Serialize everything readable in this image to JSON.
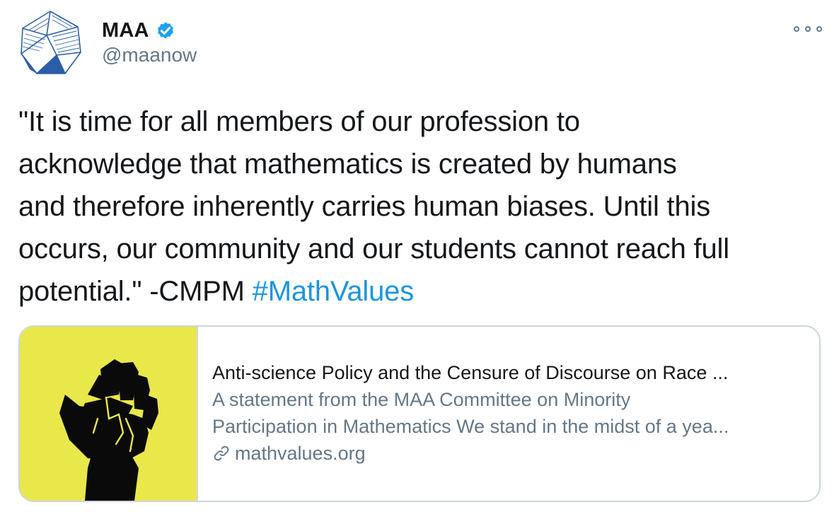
{
  "author": {
    "display_name": "MAA",
    "handle": "@maanow",
    "verified": true
  },
  "tweet": {
    "lines": [
      "\"It is time for all members of our profession to",
      "acknowledge that mathematics is created by humans",
      "and therefore inherently carries human biases. Until this",
      "occurs, our community and our students cannot reach full",
      "potential.\" -CMPM "
    ],
    "hashtag": "#MathValues"
  },
  "card": {
    "title": "Anti-science Policy and the Censure of Discourse on Race ...",
    "description_lines": [
      "A statement from the MAA Committee on Minority",
      "Participation in Mathematics We stand in the midst of a yea..."
    ],
    "domain": "mathvalues.org",
    "image_icon": "raised-fist-icon"
  },
  "icons": {
    "avatar": "maa-polyhedron-logo",
    "verified": "verified-badge-icon",
    "more": "more-options-icon",
    "link": "link-icon"
  },
  "colors": {
    "text": "#14171a",
    "secondary": "#657786",
    "link": "#1b95e0",
    "verified": "#1da1f2",
    "card_image_bg": "#e8e84a",
    "border": "#ccd6dd"
  }
}
